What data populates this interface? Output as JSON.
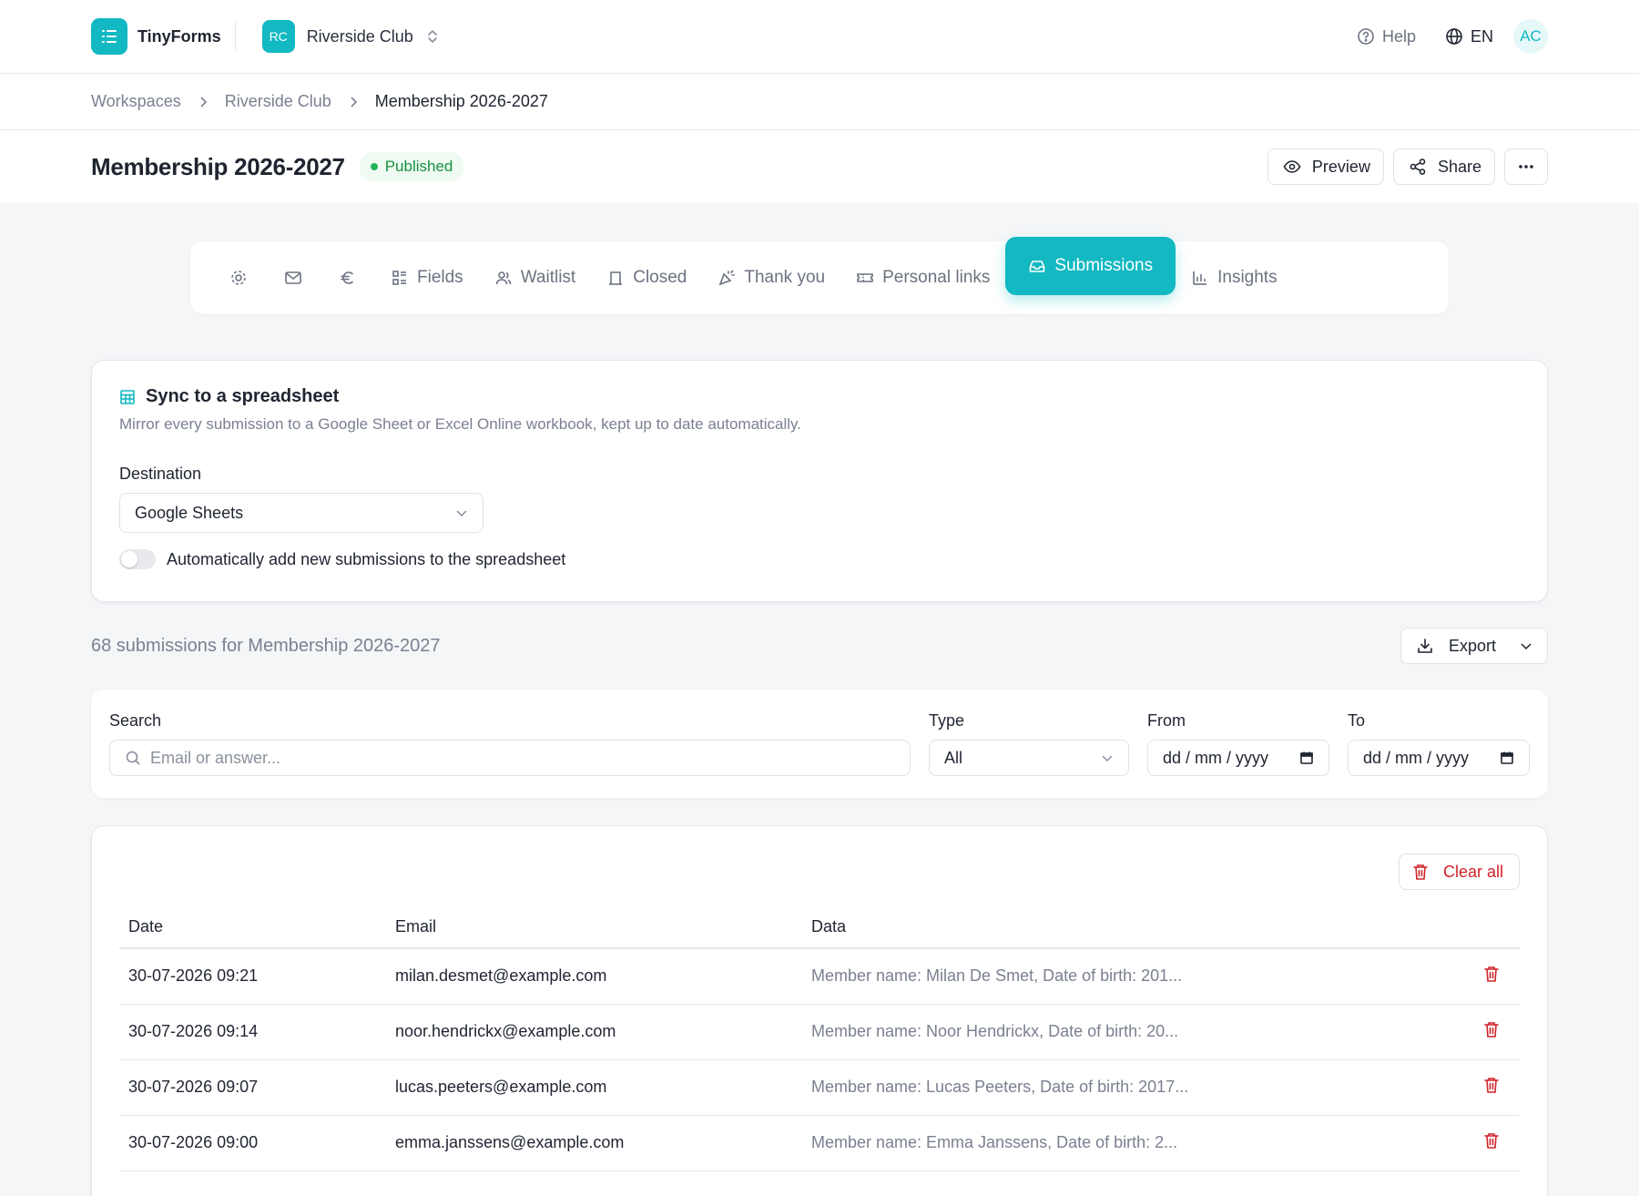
{
  "app": {
    "name": "TinyForms",
    "workspace_initials": "RC",
    "workspace_name": "Riverside Club",
    "help_label": "Help",
    "language": "EN",
    "user_initials": "AC"
  },
  "breadcrumb": [
    "Workspaces",
    "Riverside Club",
    "Membership 2026-2027"
  ],
  "page": {
    "title": "Membership 2026-2027",
    "status": "Published",
    "preview_label": "Preview",
    "share_label": "Share"
  },
  "tabs": [
    {
      "label": "",
      "icon": "gear-icon"
    },
    {
      "label": "",
      "icon": "mail-icon"
    },
    {
      "label": "",
      "icon": "euro-icon"
    },
    {
      "label": "Fields",
      "icon": "fields-icon"
    },
    {
      "label": "Waitlist",
      "icon": "users-icon"
    },
    {
      "label": "Closed",
      "icon": "closed-icon"
    },
    {
      "label": "Thank you",
      "icon": "party-icon"
    },
    {
      "label": "Personal links",
      "icon": "ticket-icon"
    },
    {
      "label": "Submissions",
      "icon": "inbox-icon",
      "active": true
    },
    {
      "label": "Insights",
      "icon": "chart-icon"
    }
  ],
  "sync": {
    "title": "Sync to a spreadsheet",
    "description": "Mirror every submission to a Google Sheet or Excel Online workbook, kept up to date automatically.",
    "destination_label": "Destination",
    "destination_value": "Google Sheets",
    "auto_add_label": "Automatically add new submissions to the spreadsheet",
    "auto_add_enabled": false
  },
  "summary": {
    "text": "68 submissions for Membership 2026-2027",
    "export_label": "Export"
  },
  "filters": {
    "search_label": "Search",
    "search_placeholder": "Email or answer...",
    "type_label": "Type",
    "type_value": "All",
    "from_label": "From",
    "from_placeholder": "dd / mm / yyyy",
    "to_label": "To",
    "to_placeholder": "dd / mm / yyyy"
  },
  "table": {
    "clear_all_label": "Clear all",
    "columns": [
      "Date",
      "Email",
      "Data"
    ],
    "rows": [
      {
        "date": "30-07-2026 09:21",
        "email": "milan.desmet@example.com",
        "data": "Member name: Milan De Smet, Date of birth: 201..."
      },
      {
        "date": "30-07-2026 09:14",
        "email": "noor.hendrickx@example.com",
        "data": "Member name: Noor Hendrickx, Date of birth: 20..."
      },
      {
        "date": "30-07-2026 09:07",
        "email": "lucas.peeters@example.com",
        "data": "Member name: Lucas Peeters, Date of birth: 2017..."
      },
      {
        "date": "30-07-2026 09:00",
        "email": "emma.janssens@example.com",
        "data": "Member name: Emma Janssens, Date of birth: 2..."
      }
    ]
  },
  "colors": {
    "accent": "#12b8c2",
    "danger": "#d1232a",
    "published": "#17913f"
  }
}
